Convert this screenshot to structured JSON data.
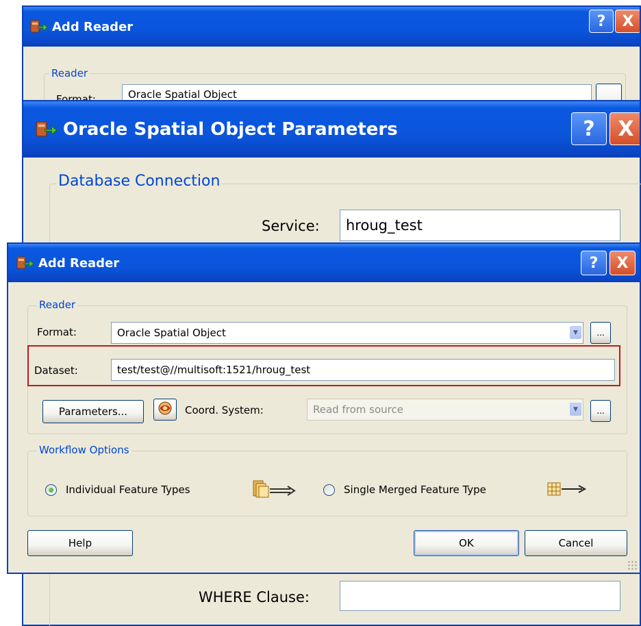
{
  "back_dialog": {
    "title": "Add Reader",
    "group_label": "Reader",
    "format_label": "Format:",
    "format_value": "Oracle Spatial Object"
  },
  "mid_dialog": {
    "title": "Oracle Spatial Object Parameters",
    "group_label": "Database Connection",
    "service_label": "Service:",
    "service_value": "hroug_test",
    "where_label": "WHERE Clause:",
    "where_value": ""
  },
  "front_dialog": {
    "title": "Add Reader",
    "reader_group": "Reader",
    "format_label": "Format:",
    "format_value": "Oracle Spatial Object",
    "dataset_label": "Dataset:",
    "dataset_value": "test/test@//multisoft:1521/hroug_test",
    "parameters_button": "Parameters...",
    "coord_label": "Coord. System:",
    "coord_value": "Read from source",
    "workflow_group": "Workflow Options",
    "option_individual": "Individual Feature Types",
    "option_single": "Single Merged Feature Type",
    "selected_option": "Individual Feature Types",
    "help_button": "Help",
    "ok_button": "OK",
    "cancel_button": "Cancel",
    "ellipsis": "..."
  },
  "icons": {
    "help": "?",
    "close": "X",
    "app": "fme-reader-icon",
    "coord": "coordinate-system-icon"
  },
  "colors": {
    "titlebar": "#0a55dc",
    "highlight": "#c0191c",
    "legend_text": "#0046d5"
  }
}
